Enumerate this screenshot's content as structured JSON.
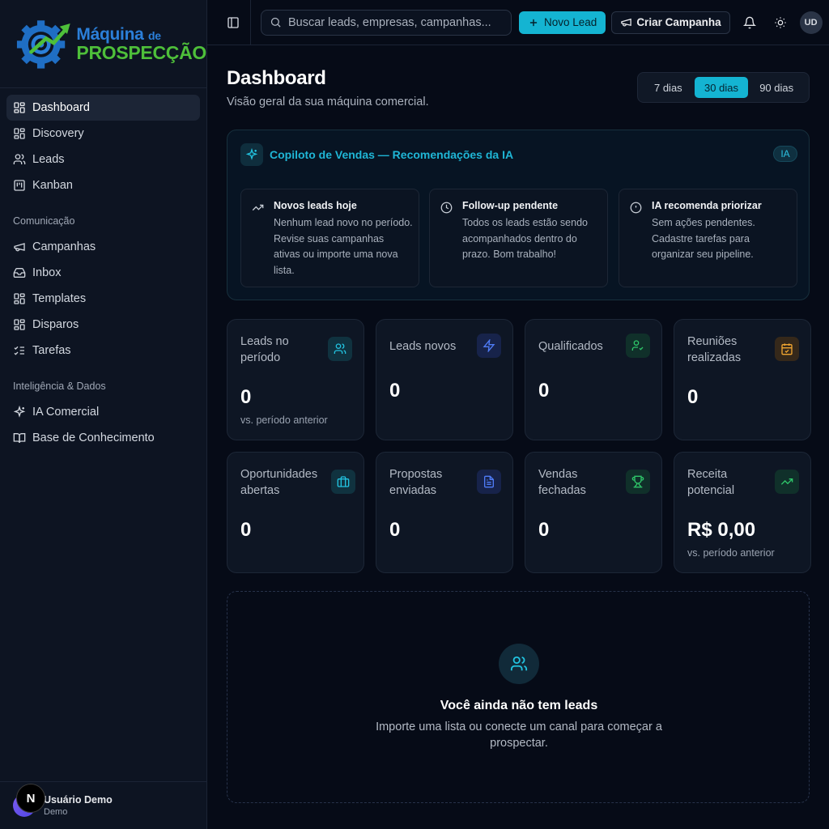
{
  "brand": {
    "line1": "Máquina",
    "line1_small": "de",
    "line2": "PROSPECÇÃO"
  },
  "sidebar": {
    "items": [
      {
        "label": "Dashboard",
        "icon": "grid-icon",
        "active": true
      },
      {
        "label": "Discovery",
        "icon": "grid-icon"
      },
      {
        "label": "Leads",
        "icon": "users-icon"
      },
      {
        "label": "Kanban",
        "icon": "kanban-icon"
      }
    ],
    "group_comunicacao": "Comunicação",
    "comunicacao": [
      {
        "label": "Campanhas",
        "icon": "megaphone-icon"
      },
      {
        "label": "Inbox",
        "icon": "inbox-icon"
      },
      {
        "label": "Templates",
        "icon": "grid-icon"
      },
      {
        "label": "Disparos",
        "icon": "grid-icon"
      },
      {
        "label": "Tarefas",
        "icon": "list-checks-icon"
      }
    ],
    "group_inteligencia": "Inteligência & Dados",
    "inteligencia": [
      {
        "label": "IA Comercial",
        "icon": "sparkles-icon"
      },
      {
        "label": "Base de Conhecimento",
        "icon": "book-icon"
      }
    ],
    "user": {
      "name": "Usuário Demo",
      "role": "Demo",
      "badge": "N"
    }
  },
  "topbar": {
    "search_placeholder": "Buscar leads, empresas, campanhas...",
    "new_lead": "Novo Lead",
    "create_campaign": "Criar Campanha",
    "avatar": "UD"
  },
  "header": {
    "title": "Dashboard",
    "subtitle": "Visão geral da sua máquina comercial.",
    "ranges": [
      "7 dias",
      "30 dias",
      "90 dias"
    ],
    "selected_range": "30 dias"
  },
  "copilot": {
    "title": "Copiloto de Vendas — Recomendações da IA",
    "badge": "IA",
    "cards": [
      {
        "title": "Novos leads hoje",
        "body": "Nenhum lead novo no período. Revise suas campanhas ativas ou importe uma nova lista.",
        "icon": "trending-up-icon"
      },
      {
        "title": "Follow-up pendente",
        "body": "Todos os leads estão sendo acompanhados dentro do prazo. Bom trabalho!",
        "icon": "clock-icon"
      },
      {
        "title": "IA recomenda priorizar",
        "body": "Sem ações pendentes. Cadastre tarefas para organizar seu pipeline.",
        "icon": "alert-circle-icon"
      }
    ]
  },
  "stats": [
    {
      "label": "Leads no período",
      "value": "0",
      "sub": "vs. período anterior",
      "icon": "users-icon",
      "color": "#22c3e0"
    },
    {
      "label": "Leads novos",
      "value": "0",
      "sub": "",
      "icon": "zap-icon",
      "color": "#4f7cf7"
    },
    {
      "label": "Qualificados",
      "value": "0",
      "sub": "",
      "icon": "user-check-icon",
      "color": "#2fc76a"
    },
    {
      "label": "Reuniões realizadas",
      "value": "0",
      "sub": "",
      "icon": "calendar-check-icon",
      "color": "#f0a531"
    },
    {
      "label": "Oportunidades abertas",
      "value": "0",
      "sub": "",
      "icon": "briefcase-icon",
      "color": "#22c3e0"
    },
    {
      "label": "Propostas enviadas",
      "value": "0",
      "sub": "",
      "icon": "file-text-icon",
      "color": "#4f7cf7"
    },
    {
      "label": "Vendas fechadas",
      "value": "0",
      "sub": "",
      "icon": "trophy-icon",
      "color": "#2fc76a"
    },
    {
      "label": "Receita potencial",
      "value": "R$ 0,00",
      "sub": "vs. período anterior",
      "icon": "trending-up-icon",
      "color": "#2fc76a"
    }
  ],
  "empty_state": {
    "title": "Você ainda não tem leads",
    "text": "Importe uma lista ou conecte um canal para começar a prospectar.",
    "icon": "users-icon"
  }
}
